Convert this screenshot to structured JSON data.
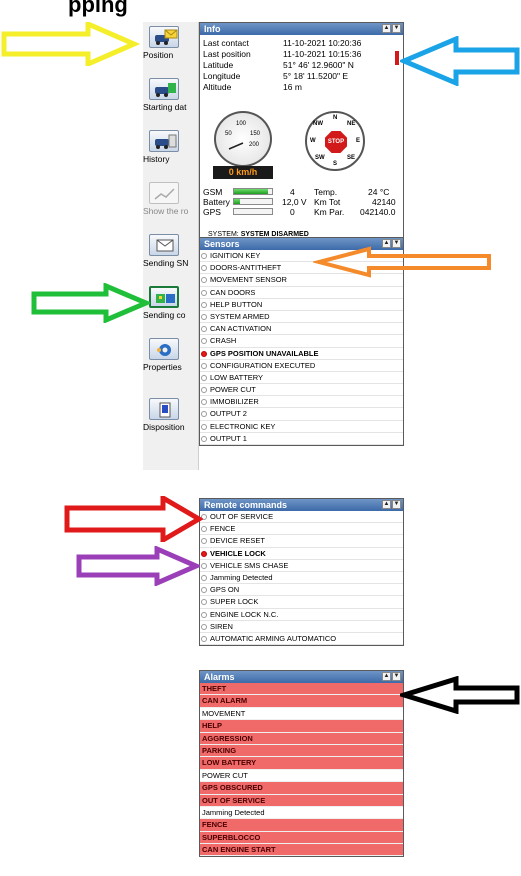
{
  "page_title": "pping",
  "toolbar": {
    "items": [
      {
        "label": "Position",
        "icon": "envelope-car-icon"
      },
      {
        "label": "Starting dat",
        "icon": "car-icon"
      },
      {
        "label": "History",
        "icon": "car-history-icon"
      },
      {
        "label": "Show the ro",
        "icon": "route-chart-icon",
        "disabled": true
      },
      {
        "label": "Sending SN",
        "icon": "send-sms-icon"
      },
      {
        "label": "Sending co",
        "icon": "send-command-icon"
      },
      {
        "label": "Properties",
        "icon": "properties-gear-icon"
      },
      {
        "label": "Disposition",
        "icon": "disposition-icon"
      }
    ]
  },
  "info": {
    "title": "Info",
    "rows": [
      {
        "label": "Last contact",
        "value": "11-10-2021 10:20:36"
      },
      {
        "label": "Last position",
        "value": "11-10-2021 10:15:36"
      },
      {
        "label": "Latitude",
        "value": "51° 46' 12.9600\" N"
      },
      {
        "label": "Longitude",
        "value": "5° 18' 11.5200\" E"
      },
      {
        "label": "Altitude",
        "value": "16 m"
      }
    ],
    "speed": "0 km/h",
    "gauge_ticks": [
      "50",
      "100",
      "150",
      "200"
    ],
    "compass_dirs": [
      "N",
      "NE",
      "E",
      "SE",
      "S",
      "SW",
      "W",
      "NW"
    ],
    "stop_text": "STOP",
    "stats": {
      "gsm_label": "GSM",
      "gsm_value": "4",
      "gsm_level": 0.9,
      "battery_label": "Battery",
      "battery_value": "12,0 V",
      "battery_level": 0.15,
      "gps_label": "GPS",
      "gps_value": "0",
      "gps_level": 0.0,
      "temp_label": "Temp.",
      "temp_value": "24 °C",
      "kmtot_label": "Km Tot",
      "kmtot_value": "42140",
      "kmpar_label": "Km Par.",
      "kmpar_value": "042140.0"
    },
    "system_label": "SYSTEM:",
    "system_value": "SYSTEM DISARMED"
  },
  "sensors": {
    "title": "Sensors",
    "items": [
      {
        "label": "IGNITION KEY",
        "active": false
      },
      {
        "label": "DOORS-ANTITHEFT",
        "active": false
      },
      {
        "label": "MOVEMENT SENSOR",
        "active": false
      },
      {
        "label": "CAN DOORS",
        "active": false
      },
      {
        "label": "HELP BUTTON",
        "active": false
      },
      {
        "label": "SYSTEM ARMED",
        "active": false
      },
      {
        "label": "CAN ACTIVATION",
        "active": false
      },
      {
        "label": "CRASH",
        "active": false
      },
      {
        "label": "GPS POSITION UNAVAILABLE",
        "active": true
      },
      {
        "label": "CONFIGURATION EXECUTED",
        "active": false
      },
      {
        "label": "LOW BATTERY",
        "active": false
      },
      {
        "label": "POWER CUT",
        "active": false
      },
      {
        "label": "IMMOBILIZER",
        "active": false
      },
      {
        "label": "OUTPUT 2",
        "active": false
      },
      {
        "label": "ELECTRONIC KEY",
        "active": false
      },
      {
        "label": "OUTPUT 1",
        "active": false
      }
    ]
  },
  "remote_commands": {
    "title": "Remote commands",
    "items": [
      {
        "label": "OUT OF SERVICE",
        "active": false
      },
      {
        "label": "FENCE",
        "active": false
      },
      {
        "label": "DEVICE RESET",
        "active": false
      },
      {
        "label": "VEHICLE LOCK",
        "active": true
      },
      {
        "label": "VEHICLE SMS CHASE",
        "active": false
      },
      {
        "label": "Jamming Detected",
        "active": false
      },
      {
        "label": "GPS ON",
        "active": false
      },
      {
        "label": "SUPER LOCK",
        "active": false
      },
      {
        "label": "ENGINE LOCK N.C.",
        "active": false
      },
      {
        "label": "SIREN",
        "active": false
      },
      {
        "label": "AUTOMATIC ARMING AUTOMATICO",
        "active": false
      }
    ]
  },
  "alarms": {
    "title": "Alarms",
    "items": [
      {
        "label": "THEFT",
        "active": true
      },
      {
        "label": "CAN ALARM",
        "active": true
      },
      {
        "label": "MOVEMENT",
        "active": false
      },
      {
        "label": "HELP",
        "active": true
      },
      {
        "label": "AGGRESSION",
        "active": true
      },
      {
        "label": "PARKING",
        "active": true
      },
      {
        "label": "LOW BATTERY",
        "active": true
      },
      {
        "label": "POWER CUT",
        "active": false
      },
      {
        "label": "GPS OBSCURED",
        "active": true
      },
      {
        "label": "OUT OF SERVICE",
        "active": true
      },
      {
        "label": "Jamming Detected",
        "active": false
      },
      {
        "label": "FENCE",
        "active": true
      },
      {
        "label": "SUPERBLOCCO",
        "active": true
      },
      {
        "label": "CAN ENGINE START",
        "active": true
      }
    ]
  },
  "annotations": {
    "colors": {
      "yellow": "#f5ee2a",
      "blue": "#1aa3e6",
      "orange": "#f58a2a",
      "green": "#1fbf3a",
      "red": "#e01a1a",
      "purple": "#9b3fb8",
      "black": "#000000"
    }
  },
  "accent_colors": {
    "panel_header": "#3d6aa8",
    "alarm_active": "#f06a6a",
    "active_radio": "#e01a1a",
    "bar_fill": "#1f9e1f"
  }
}
